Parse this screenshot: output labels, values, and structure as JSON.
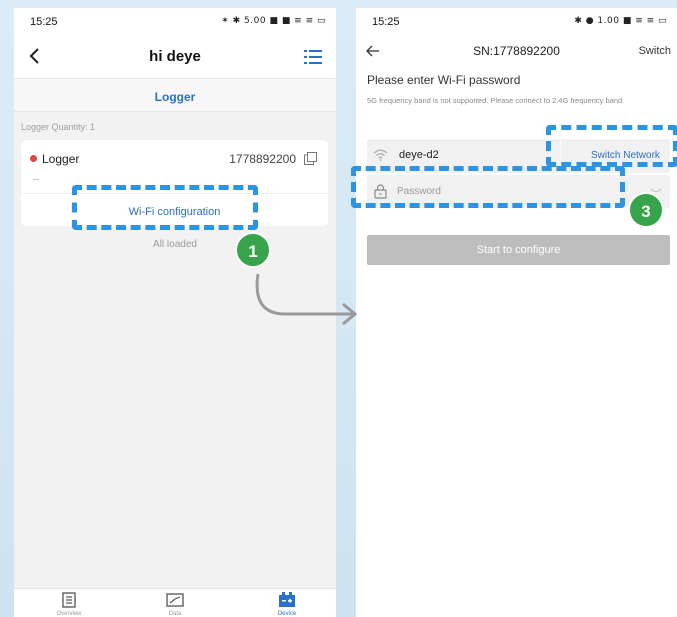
{
  "left_screen": {
    "status": {
      "time": "15:25",
      "icons": "✶ ✱ 5.00 ■ ■ ≡ ≡ ▭"
    },
    "header": {
      "title": "hi deye"
    },
    "tab": {
      "label": "Logger"
    },
    "logger_quantity": "Logger Quantity: 1",
    "card": {
      "name": "Logger",
      "serial": "1778892200",
      "placeholder": "--",
      "wifi_config": "Wi-Fi configuration"
    },
    "all_loaded": "All loaded",
    "nav": [
      {
        "label": "Overview",
        "icon": "overview-icon"
      },
      {
        "label": "Data",
        "icon": "data-icon"
      },
      {
        "label": "Device",
        "icon": "device-icon"
      }
    ]
  },
  "right_screen": {
    "status": {
      "time": "15:25",
      "icons": "✱ ● 1.00 ■ ≡ ≡ ▭"
    },
    "header": {
      "title": "SN:1778892200",
      "switch": "Switch"
    },
    "prompt": "Please enter Wi-Fi password",
    "note": "5G frequency band is not supported. Please connect to 2.4G frequency band.",
    "network": {
      "ssid": "deye-d2",
      "switch_label": "Switch Network"
    },
    "password": {
      "placeholder": "Password",
      "value": ""
    },
    "start_button": "Start to configure"
  },
  "annotations": {
    "step1": "1",
    "step3": "3",
    "accent": "#2b94e3",
    "badge_color": "#37a34a"
  },
  "colors": {
    "link_blue": "#2a6fc9",
    "status_red": "#e04545",
    "disabled_button": "#bdbdbd"
  }
}
